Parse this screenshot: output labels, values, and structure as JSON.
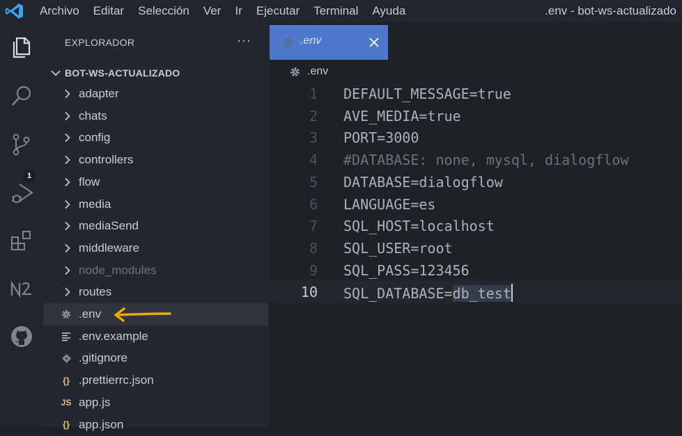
{
  "menubar": {
    "items": [
      "Archivo",
      "Editar",
      "Selección",
      "Ver",
      "Ir",
      "Ejecutar",
      "Terminal",
      "Ayuda"
    ],
    "window_title": ".env - bot-ws-actualizado"
  },
  "activitybar": {
    "items": [
      "files-icon",
      "search-icon",
      "source-control-icon",
      "run-debug-icon",
      "extensions-icon",
      "nx-icon",
      "github-icon"
    ],
    "source_control_badge": "1"
  },
  "sidebar": {
    "title": "EXPLORADOR",
    "more": "···",
    "root": "BOT-WS-ACTUALIZADO",
    "items": [
      {
        "label": "adapter",
        "type": "folder"
      },
      {
        "label": "chats",
        "type": "folder"
      },
      {
        "label": "config",
        "type": "folder"
      },
      {
        "label": "controllers",
        "type": "folder"
      },
      {
        "label": "flow",
        "type": "folder"
      },
      {
        "label": "media",
        "type": "folder"
      },
      {
        "label": "mediaSend",
        "type": "folder"
      },
      {
        "label": "middleware",
        "type": "folder"
      },
      {
        "label": "node_modules",
        "type": "folder",
        "dimmed": true
      },
      {
        "label": "routes",
        "type": "folder"
      },
      {
        "label": ".env",
        "type": "settings-file",
        "selected": true
      },
      {
        "label": ".env.example",
        "type": "text-file"
      },
      {
        "label": ".gitignore",
        "type": "git-file"
      },
      {
        "label": ".prettierrc.json",
        "type": "json-file"
      },
      {
        "label": "app.js",
        "type": "js-file"
      },
      {
        "label": "app.json",
        "type": "json-file"
      }
    ]
  },
  "editor": {
    "tab": {
      "label": ".env",
      "icon": "gear-icon"
    },
    "breadcrumb": ".env",
    "current_line": 10,
    "lines": [
      {
        "n": "1",
        "text": "DEFAULT_MESSAGE=true"
      },
      {
        "n": "2",
        "text": "AVE_MEDIA=true"
      },
      {
        "n": "3",
        "text": "PORT=3000"
      },
      {
        "n": "4",
        "text": "#DATABASE: none, mysql, dialogflow",
        "comment": true
      },
      {
        "n": "5",
        "text": "DATABASE=dialogflow"
      },
      {
        "n": "6",
        "text": "LANGUAGE=es"
      },
      {
        "n": "7",
        "text": "SQL_HOST=localhost"
      },
      {
        "n": "8",
        "text": "SQL_USER=root"
      },
      {
        "n": "9",
        "text": "SQL_PASS=123456"
      },
      {
        "n": "10",
        "text": "SQL_DATABASE=",
        "selected_text": "db_test"
      }
    ]
  },
  "colors": {
    "accent_tab": "#4d78cc",
    "annotation_arrow": "#f0a800",
    "vscode_blue": "#3aa3f0"
  }
}
